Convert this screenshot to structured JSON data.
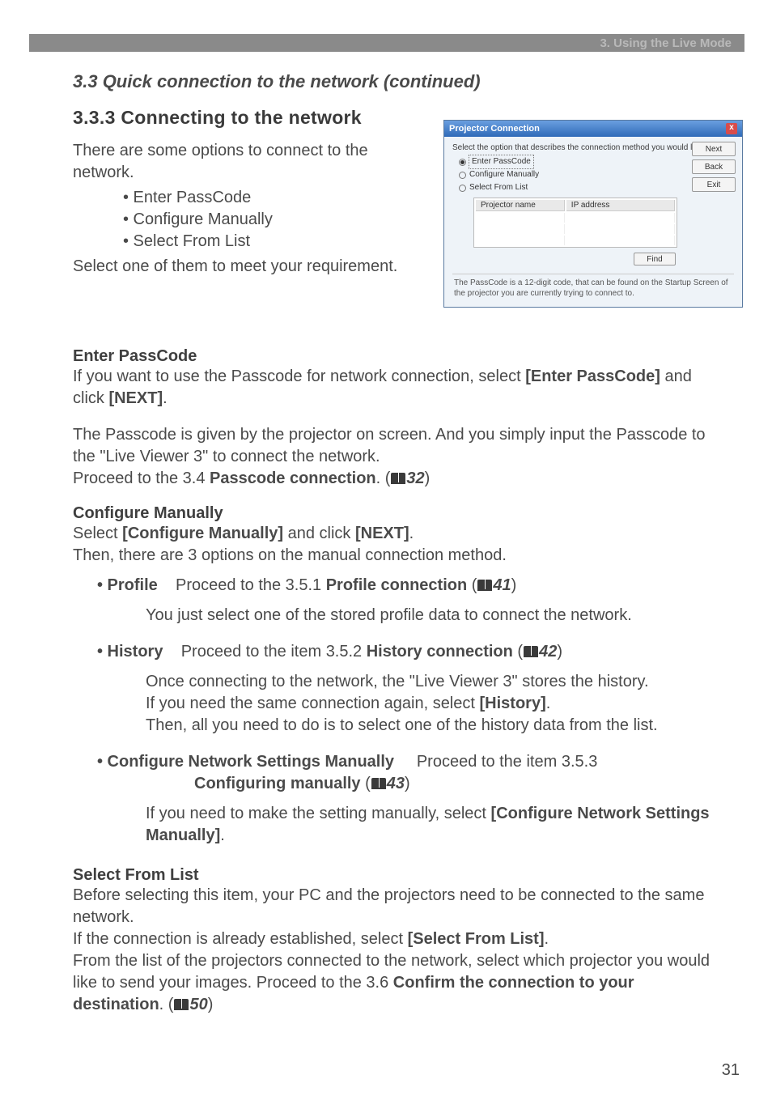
{
  "header_bar": {
    "label": "3. Using the Live Mode"
  },
  "titles": {
    "section": "3.3 Quick connection to the network (continued)",
    "subsection": "3.3.3 Connecting to the network"
  },
  "intro": {
    "line1": "There are some options to connect to the network.",
    "bullets": [
      "• Enter PassCode",
      "• Configure Manually",
      "• Select From List"
    ],
    "line2": "Select one of them to meet your requirement."
  },
  "enter_passcode": {
    "heading": "Enter PassCode",
    "p1a": "If you want to use the Passcode for network connection, select ",
    "p1b": "[Enter PassCode]",
    "p1c": " and click ",
    "p1d": "[NEXT]",
    "p1e": ".",
    "p2": "The Passcode is given by the projector on screen. And you simply input the Passcode to the \"Live Viewer 3\" to connect the network.",
    "p3a": "Proceed to the 3.4 ",
    "p3b": "Passcode connection",
    "p3c": ". (",
    "p3_ref": "32",
    "p3d": ")"
  },
  "configure_manually": {
    "heading": "Configure Manually",
    "l1a": "Select ",
    "l1b": "[Configure Manually]",
    "l1c": " and click ",
    "l1d": "[NEXT]",
    "l1e": ".",
    "l2": "Then, there are 3 options on the manual connection method.",
    "profile": {
      "label": "• Profile",
      "txt_a": "Proceed to the 3.5.1 ",
      "txt_b": "Profile connection",
      "txt_c": " (",
      "ref": "41",
      "txt_d": ")",
      "desc": "You just select one of the stored profile data to connect the network."
    },
    "history": {
      "label": "• History",
      "txt_a": "Proceed to the item 3.5.2 ",
      "txt_b": "History connection",
      "txt_c": " (",
      "ref": "42",
      "txt_d": ")",
      "desc1": "Once connecting to the network, the \"Live Viewer 3\" stores the history.",
      "desc2a": "If you need the same connection again, select ",
      "desc2b": "[History]",
      "desc2c": ".",
      "desc3": "Then, all you need to do is to select one of the history data from the list."
    },
    "cfg_net": {
      "label": "• Configure Network Settings Manually",
      "txt_a": "Proceed to the item 3.5.3",
      "line2a": "Configuring manually",
      "line2b": " (",
      "ref": "43",
      "line2c": ")",
      "desc_a": "If you need to make the setting manually, select ",
      "desc_b": "[Configure Network Settings Manually]",
      "desc_c": "."
    }
  },
  "select_from_list": {
    "heading": "Select From List",
    "p1": "Before selecting this item, your PC and the projectors need to be connected to the same network.",
    "p2a": "If the connection is already established, select ",
    "p2b": "[Select From List]",
    "p2c": ".",
    "p3a": "From the list of the projectors connected to the network, select which projector you would like to send your images. Proceed to the 3.6 ",
    "p3b": "Confirm the connection to your destination",
    "p3c": ". (",
    "ref": "50",
    "p3d": ")"
  },
  "page_number": "31",
  "dialog": {
    "title": "Projector Connection",
    "prompt": "Select the option that describes the connection method you would like to use.",
    "opt1": "Enter PassCode",
    "opt2": "Configure Manually",
    "opt3": "Select From List",
    "col1": "Projector name",
    "col2": "IP address",
    "btn_next": "Next",
    "btn_back": "Back",
    "btn_exit": "Exit",
    "btn_find": "Find",
    "note": "The PassCode is a 12-digit code, that can be found on the Startup Screen of the projector you are currently trying to connect to."
  }
}
